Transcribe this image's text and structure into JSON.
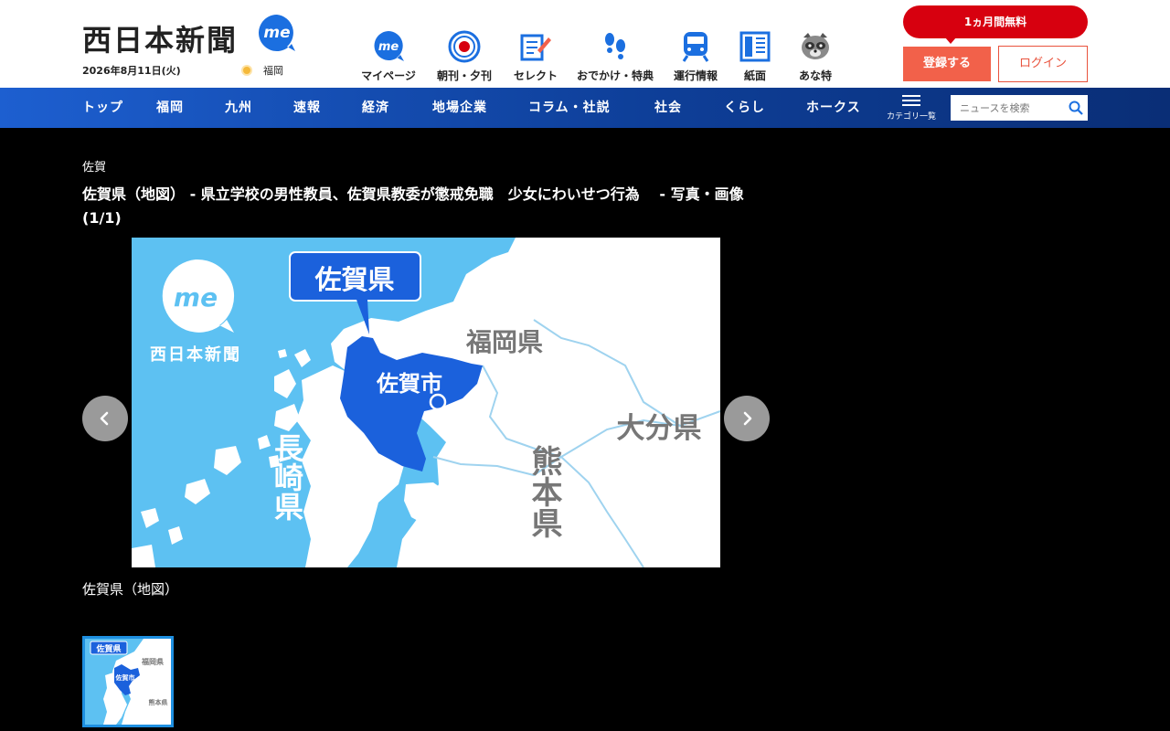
{
  "header": {
    "logo_text": "西日本新聞",
    "logo_badge": "me",
    "date": "2026年8月11日(火)",
    "weather_location": "福岡",
    "quick_nav": [
      {
        "label": "マイページ",
        "icon": "me-icon"
      },
      {
        "label": "朝刊・夕刊",
        "icon": "newspaper-edition-icon"
      },
      {
        "label": "セレクト",
        "icon": "select-pen-icon"
      },
      {
        "label": "おでかけ・特典",
        "icon": "footprints-icon"
      },
      {
        "label": "運行情報",
        "icon": "train-icon"
      },
      {
        "label": "紙面",
        "icon": "paper-page-icon"
      },
      {
        "label": "あな特",
        "icon": "raccoon-icon"
      }
    ],
    "promo_label": "1ヵ月間無料",
    "register_label": "登録する",
    "login_label": "ログイン"
  },
  "nav": {
    "items": [
      "トップ",
      "福岡",
      "九州",
      "速報",
      "経済",
      "地場企業",
      "コラム・社説",
      "社会",
      "くらし",
      "ホークス"
    ],
    "category_label": "カテゴリ一覧",
    "search_placeholder": "ニュースを検索"
  },
  "article": {
    "breadcrumb": "佐賀",
    "headline": "佐賀県（地図） - 県立学校の男性教員、佐賀県教委が懲戒免職　少女にわいせつ行為　 - 写真・画像(1/1)",
    "caption": "佐賀県（地図）",
    "map": {
      "callout": "佐賀県",
      "city": "佐賀市",
      "pref_fukuoka": "福岡県",
      "pref_oita": "大分県",
      "pref_kumamoto": "熊本県",
      "pref_nagasaki": "長崎県",
      "brand": "西日本新聞",
      "brand_badge": "me"
    }
  },
  "colors": {
    "nav_blue": "#0e3f99",
    "accent_red": "#d7000f",
    "register_orange": "#f2614a",
    "sea": "#5dc1f2",
    "saga_blue": "#1b61dc"
  }
}
